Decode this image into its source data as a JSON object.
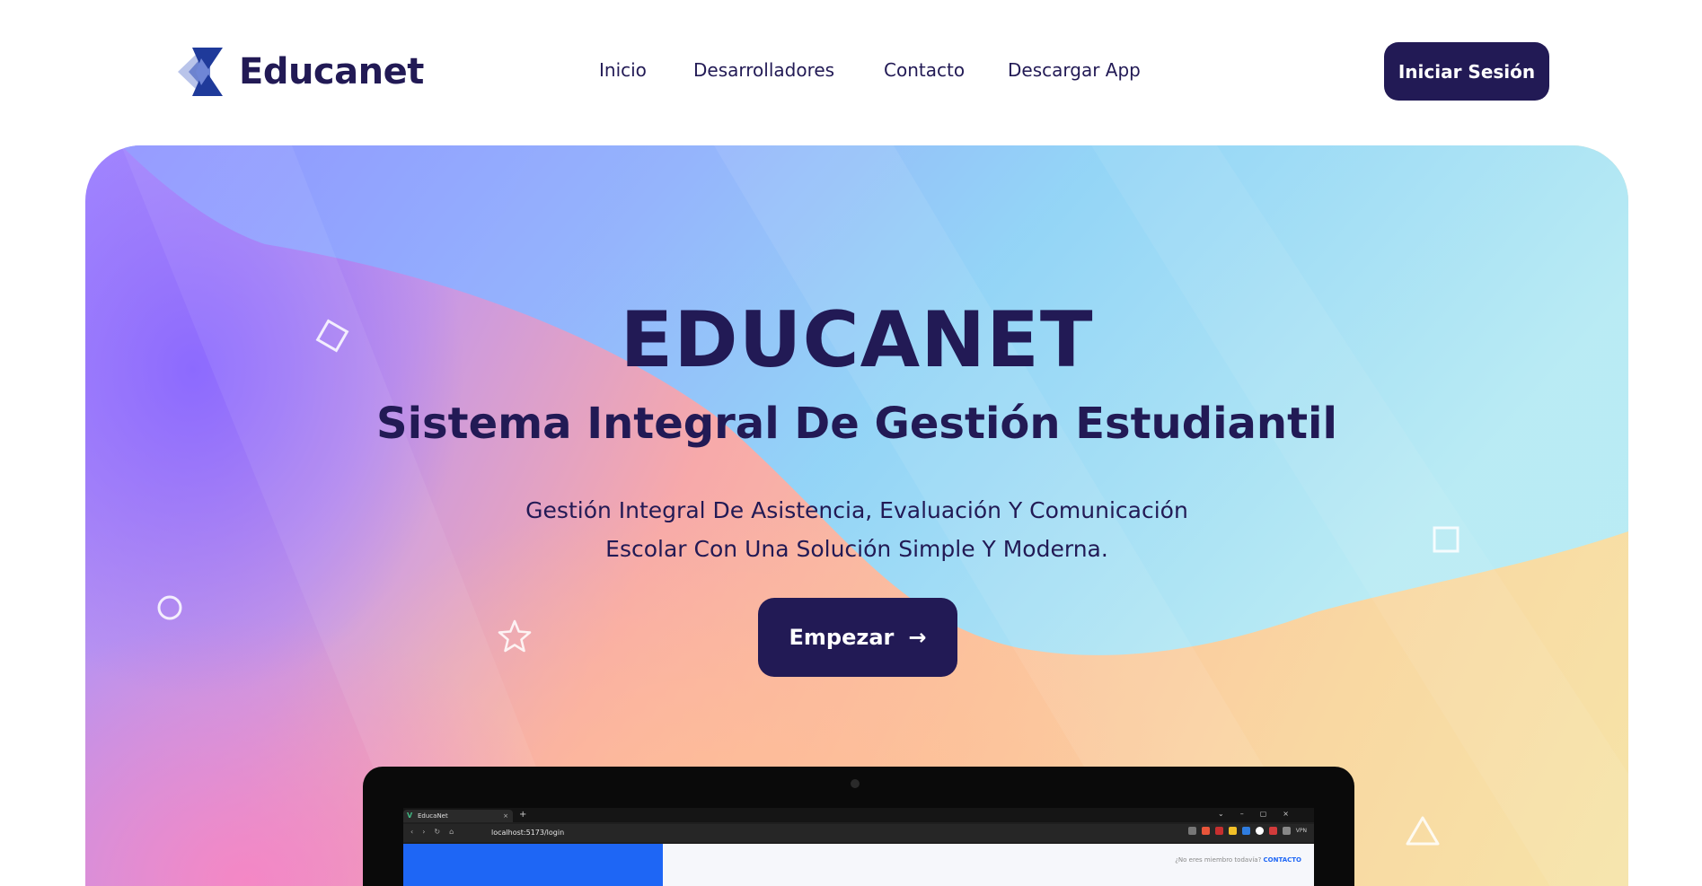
{
  "brand": {
    "name": "Educanet"
  },
  "nav": {
    "items": [
      {
        "label": "Inicio"
      },
      {
        "label": "Desarrolladores"
      },
      {
        "label": "Contacto"
      },
      {
        "label": "Descargar App"
      }
    ],
    "login_label": "Iniciar Sesión"
  },
  "hero": {
    "title": "EDUCANET",
    "subtitle": "Sistema Integral De Gestión Estudiantil",
    "description_line1": "Gestión Integral De Asistencia, Evaluación Y Comunicación",
    "description_line2": "Escolar Con Una Solución Simple Y Moderna.",
    "cta_label": "Empezar",
    "cta_icon": "arrow-right-icon"
  },
  "preview": {
    "tab_title": "EducaNet",
    "url": "localhost:5173/login",
    "vpn_label": "VPN",
    "member_prompt": "¿No eres miembro todavía?",
    "member_link": "CONTACTO"
  },
  "colors": {
    "primary": "#221a55",
    "accent_blue": "#1e66f5"
  }
}
